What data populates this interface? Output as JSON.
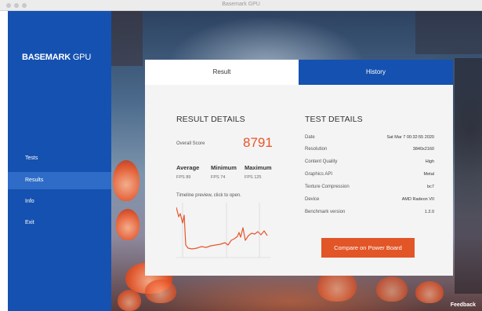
{
  "window": {
    "title": "Basemark GPU"
  },
  "sidebar": {
    "brand_main": "BASEMARK",
    "brand_sub": " GPU",
    "items": [
      {
        "label": "Tests"
      },
      {
        "label": "Results"
      },
      {
        "label": "Info"
      },
      {
        "label": "Exit"
      }
    ]
  },
  "tabs": {
    "result": "Result",
    "history": "History"
  },
  "result_details": {
    "title": "RESULT DETAILS",
    "overall_score_label": "Overall Score",
    "overall_score": "8791",
    "stats": [
      {
        "label": "Average",
        "value": "FPS 89"
      },
      {
        "label": "Minimum",
        "value": "FPS 74"
      },
      {
        "label": "Maximum",
        "value": "FPS 125"
      }
    ],
    "timeline_label": "Timeline preview, click to open.",
    "timeline_color": "#e8552a"
  },
  "test_details": {
    "title": "TEST DETAILS",
    "rows": [
      {
        "label": "Date",
        "value": "Sat Mar 7 00:32:55 2020"
      },
      {
        "label": "Resolution",
        "value": "3840x2160"
      },
      {
        "label": "Content Quality",
        "value": "High"
      },
      {
        "label": "Graphics API",
        "value": "Metal"
      },
      {
        "label": "Texture Compression",
        "value": "bc7"
      },
      {
        "label": "Device",
        "value": "AMD Radeon VII"
      },
      {
        "label": "Benchmark version",
        "value": "1.2.0"
      }
    ],
    "compare_button": "Compare on Power Board"
  },
  "feedback": "Feedback",
  "colors": {
    "sidebar": "#1551b0",
    "accent": "#e25527",
    "active_item": "#2f6cc8"
  }
}
